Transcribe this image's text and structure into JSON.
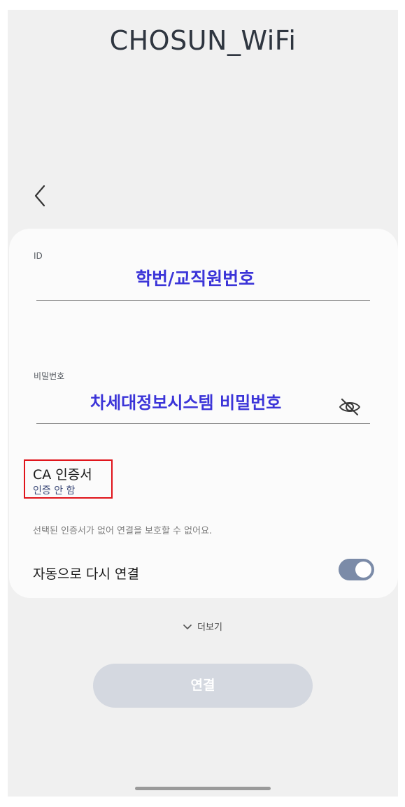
{
  "header": {
    "network_name": "CHOSUN_WiFi"
  },
  "form": {
    "id_label": "ID",
    "id_value": "학번/교직원번호",
    "password_label": "비밀번호",
    "password_value": "차세대정보시스템 비밀번호",
    "ca_cert_label": "CA 인증서",
    "ca_cert_value": "인증 안 함",
    "ca_cert_warning": "선택된 인증서가 없어 연결을 보호할 수 없어요.",
    "auto_reconnect_label": "자동으로 다시 연결",
    "auto_reconnect_on": true
  },
  "more_label": "더보기",
  "connect_label": "연결",
  "icons": {
    "back": "back-chevron-icon",
    "password_visibility": "eye-off-icon",
    "more": "chevron-down-icon"
  },
  "colors": {
    "annotation_text": "#3b34d8",
    "annotation_box": "#e0141b",
    "toggle_on": "#7b8ba8",
    "connect_disabled": "#d4d8e0"
  }
}
